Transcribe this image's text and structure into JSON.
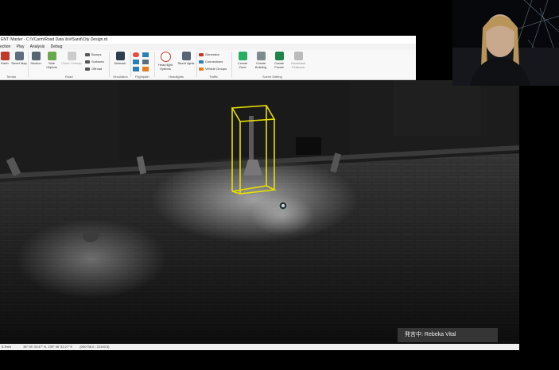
{
  "window": {
    "title": "ENT: Master - C:\\VCarm\\Road Data \\ls\\#Sand\\City Design.rd"
  },
  "menu": [
    "ection",
    "Play",
    "Analysis",
    "Debug"
  ],
  "ribbon": {
    "buttons": [
      {
        "label": "Earth"
      },
      {
        "label": "Street Map"
      },
      {
        "label": "Section"
      },
      {
        "label": "Side Objects"
      },
      {
        "label": "Clone Overlap"
      },
      {
        "label": "Bumps"
      },
      {
        "label": "Surfaces"
      },
      {
        "label": "Offroad"
      },
      {
        "label": "Network"
      },
      {
        "label": "Head light Options"
      },
      {
        "label": "Street lights"
      },
      {
        "label": "Generator"
      },
      {
        "label": "Connections"
      },
      {
        "label": "Vehicle Groups"
      },
      {
        "label": "Create Zone"
      },
      {
        "label": "Create Building"
      },
      {
        "label": "Create Forest"
      },
      {
        "label": "Download Features"
      }
    ],
    "groups": [
      "Terrain",
      "Road",
      "Simulation",
      "Flightpath",
      "Headlights",
      "Traffic",
      "Scene Editing"
    ]
  },
  "viewport": {
    "selection_color": "#e8e000"
  },
  "statusbar": {
    "left": "8.3m/s",
    "coords": "36° 05' 33.47\" N, 139° 46' 32.27\" E",
    "extra": "(000736,0 : 22100,5)"
  },
  "call": {
    "speaker_label": "発言中: Rebeka Vital"
  }
}
